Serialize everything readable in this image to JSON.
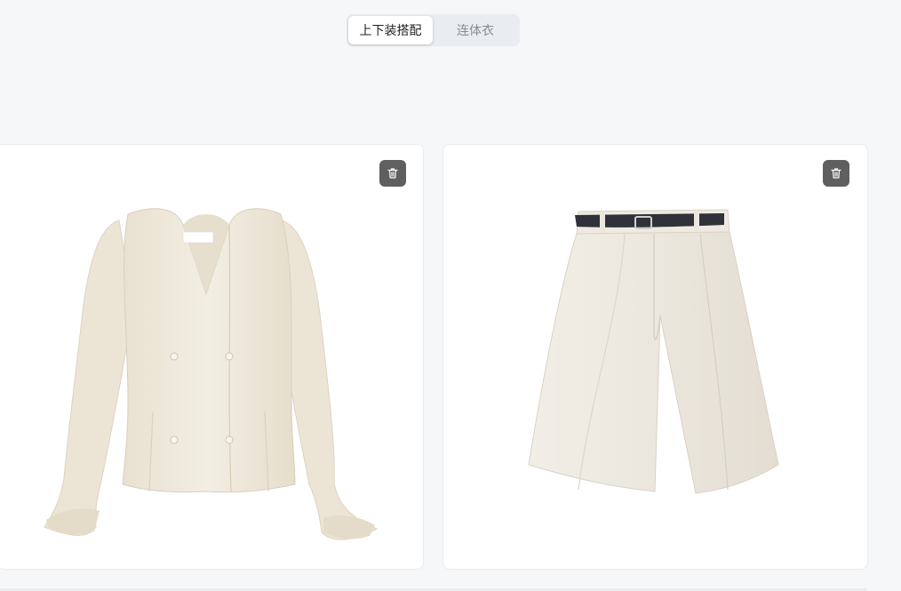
{
  "tabs": {
    "items": [
      {
        "label": "上下装搭配",
        "active": true
      },
      {
        "label": "连体衣",
        "active": false
      }
    ]
  },
  "garments": [
    {
      "kind": "blouse",
      "delete_icon": "trash-icon",
      "color": "#efe8da"
    },
    {
      "kind": "shorts",
      "delete_icon": "trash-icon",
      "color": "#ece7de",
      "belt_color": "#2f3238"
    }
  ],
  "colors": {
    "page_bg": "#f6f7f9",
    "segment_bg": "#e9ecf1",
    "delete_button_bg": "#5f5f5f"
  }
}
